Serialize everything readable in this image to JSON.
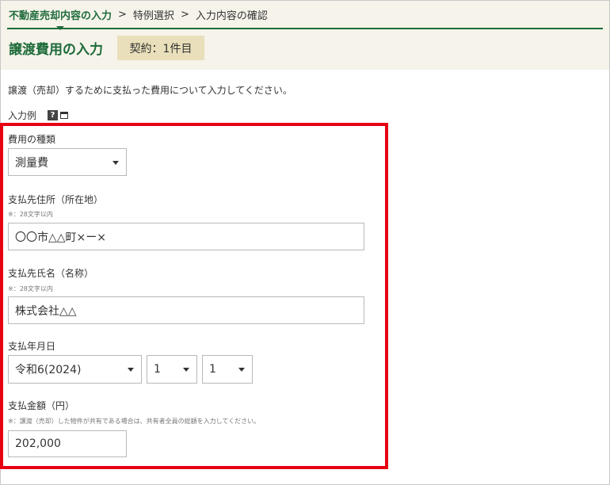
{
  "breadcrumb": {
    "current": "不動産売却内容の入力",
    "separator": ">",
    "step2": "特例選択",
    "step3": "入力内容の確認"
  },
  "page": {
    "title": "譲渡費用の入力",
    "contract_badge": "契約：1件目"
  },
  "intro_text": "譲渡（売却）するために支払った費用について入力してください。",
  "example": {
    "label": "入力例",
    "help_glyph": "?",
    "icons": [
      "help-icon",
      "popup-window-icon"
    ]
  },
  "form": {
    "expense_type": {
      "label": "費用の種類",
      "value": "測量費"
    },
    "payee_address": {
      "label": "支払先住所（所在地）",
      "note": "※：28文字以内",
      "value": "〇〇市△△町×ー×"
    },
    "payee_name": {
      "label": "支払先氏名（名称）",
      "note": "※：28文字以内",
      "value": "株式会社△△"
    },
    "payment_date": {
      "label": "支払年月日",
      "year": "令和6(2024)",
      "month": "1",
      "day": "1"
    },
    "amount": {
      "label": "支払金額（円）",
      "note": "※：譲渡（売却）した物件が共有である場合は、共有者全員の総額を入力してください。",
      "value": "202,000"
    }
  },
  "colors": {
    "brand_green": "#1e6b3a",
    "header_bg": "#f5f3ea",
    "badge_bg": "#e9dfba",
    "highlight_red": "#e60012"
  }
}
